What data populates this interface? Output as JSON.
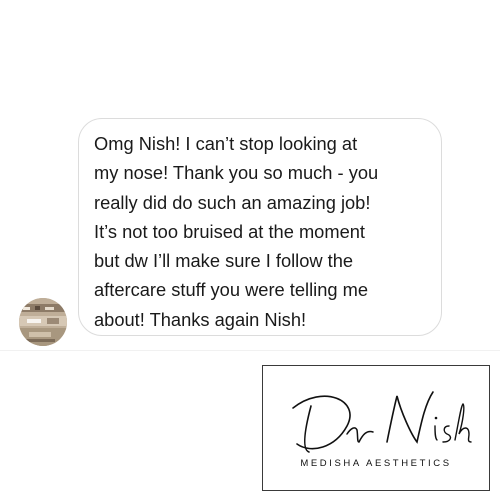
{
  "message": {
    "text": "Omg Nish! I can’t stop looking at\nmy nose! Thank you so much - you\nreally did do such an amazing job!\nIt’s not too bruised at the moment\nbut dw I’ll make sure I follow the\naftercare stuff you were telling me\nabout! Thanks again Nish!"
  },
  "sender": {
    "avatar_icon": "avatar-photo"
  },
  "logo": {
    "signature_text": "Dr Nish",
    "subtitle": "MEDISHA AESTHETICS",
    "icon": "signature-logo"
  }
}
